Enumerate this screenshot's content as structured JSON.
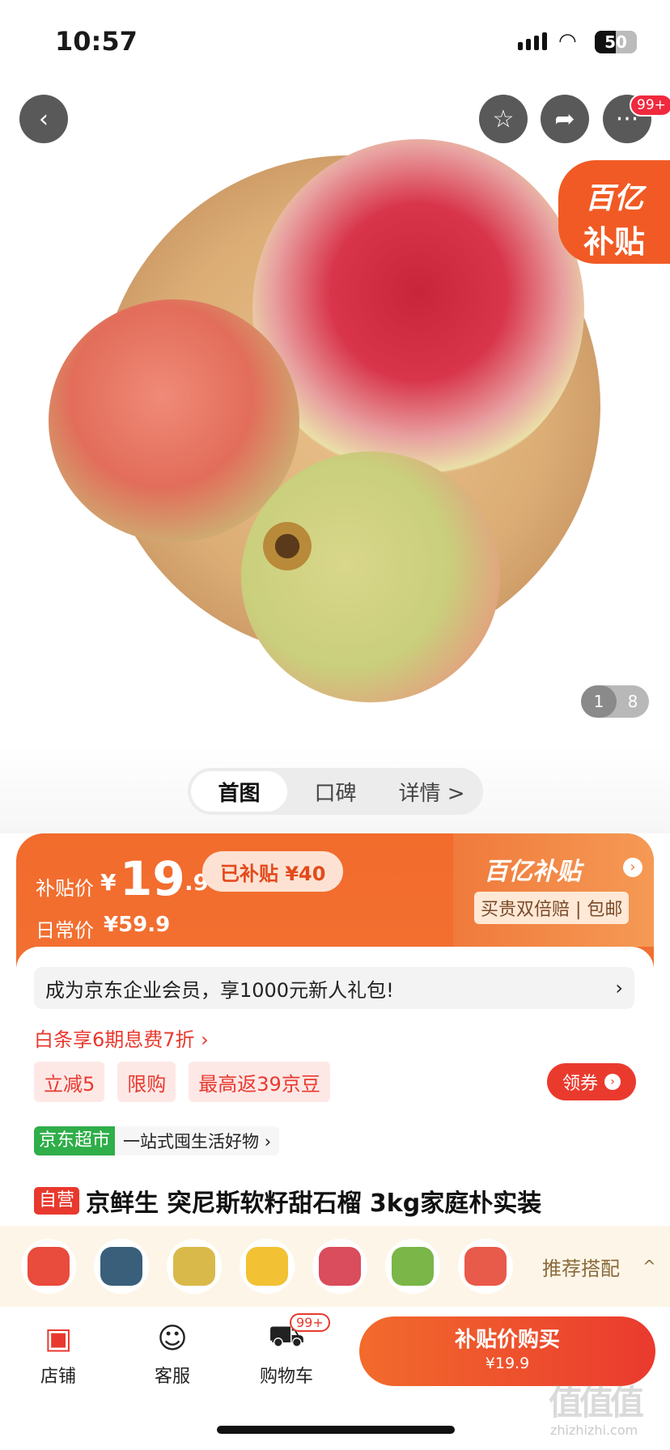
{
  "status": {
    "time": "10:57",
    "battery": "50",
    "battery_level": 0.5,
    "wifi_icon": "wifi-icon",
    "signal_icon": "signal-icon"
  },
  "header": {
    "more_badge": "99+"
  },
  "hero": {
    "subsidy_tag_line1": "百亿",
    "subsidy_tag_line2": "补贴",
    "pager_current": "1",
    "pager_total": "8"
  },
  "tabs": [
    "首图",
    "口碑",
    "详情 >"
  ],
  "price": {
    "subsidy_label": "补贴价",
    "currency": "¥",
    "subsidy_int": "19",
    "subsidy_dec": ".9",
    "already_subsidized": "已补贴 ¥40",
    "daily_label": "日常价",
    "daily_value": "¥59.9",
    "brand": "百亿补贴",
    "guarantee": "买贵双倍赔 | 包邮"
  },
  "promo": {
    "member": "成为京东企业会员，享1000元新人礼包!",
    "member_arrow": "›",
    "baitiao": "白条享6期息费7折 ›",
    "chips": [
      "立减5",
      "限购",
      "最高返39京豆"
    ],
    "coupon": "领券",
    "coupon_arrow": "›"
  },
  "store": {
    "tag": "京东超市",
    "slogan": "一站式囤生活好物 ›"
  },
  "product": {
    "self_tag": "自营",
    "title": "京鲜生 突尼斯软籽甜石榴 3kg家庭朴实装"
  },
  "recommend": {
    "label": "推荐搭配",
    "caret": "^",
    "thumb_colors": [
      "#e94b3c",
      "#3a5f7a",
      "#d9b94a",
      "#f2c234",
      "#d94d5c",
      "#7ab648",
      "#e85a4a"
    ]
  },
  "bottom_nav": {
    "store": "店铺",
    "service": "客服",
    "cart": "购物车",
    "cart_badge": "99+",
    "buy_line1": "补贴价购买",
    "buy_line2": "¥19.9"
  },
  "watermark": {
    "glyphs": "值值值",
    "site": "zhizhizhi.com"
  },
  "colors": {
    "accent": "#f26b2c",
    "red": "#e8392e",
    "green": "#2fae49"
  }
}
